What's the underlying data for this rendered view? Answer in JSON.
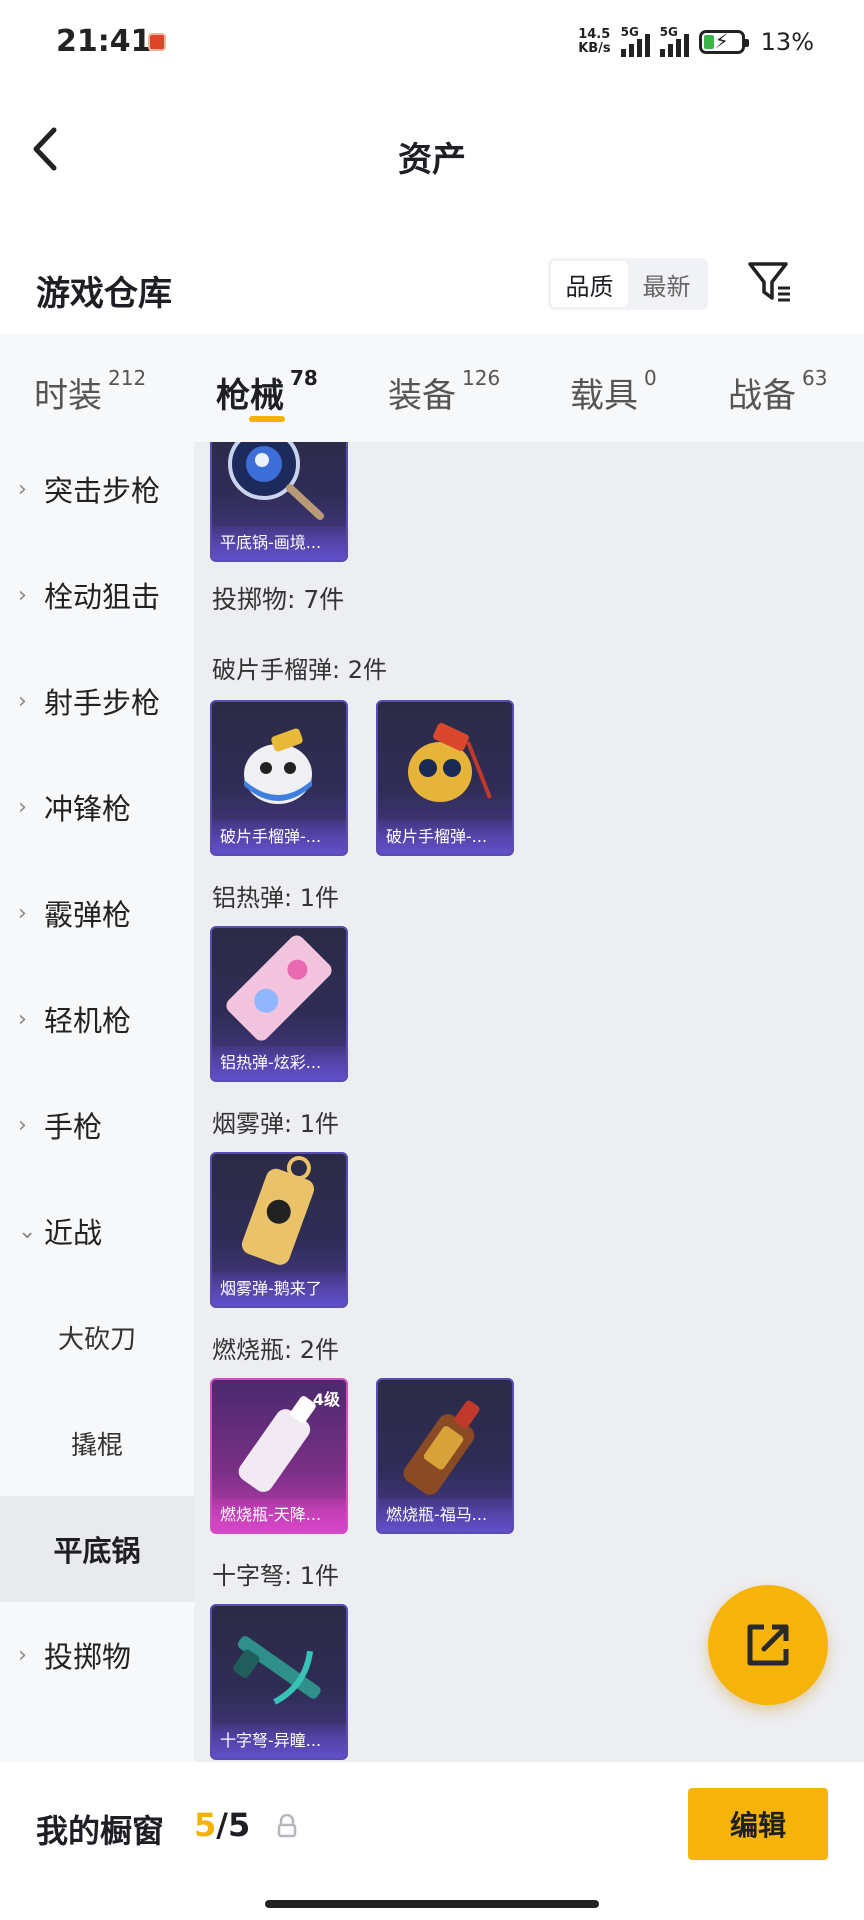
{
  "status_bar": {
    "time": "21:41",
    "speed_value": "14.5",
    "speed_unit": "KB/s",
    "network_1": "5G",
    "network_2": "5G",
    "battery": "13%"
  },
  "header": {
    "title": "资产"
  },
  "warehouse": {
    "title": "游戏仓库",
    "sort_options": [
      "品质",
      "最新"
    ],
    "sort_selected": "品质"
  },
  "tabs": [
    {
      "label": "时装",
      "count": "212"
    },
    {
      "label": "枪械",
      "count": "78"
    },
    {
      "label": "装备",
      "count": "126"
    },
    {
      "label": "载具",
      "count": "0"
    },
    {
      "label": "战备",
      "count": "63"
    }
  ],
  "active_tab": "枪械",
  "sidenav": {
    "items": [
      "突击步枪",
      "栓动狙击",
      "射手步枪",
      "冲锋枪",
      "霰弹枪",
      "轻机枪",
      "手枪",
      "近战"
    ],
    "sub_items": [
      "大砍刀",
      "撬棍",
      "平底锅"
    ],
    "selected_sub": "平底锅",
    "last_item": "投掷物"
  },
  "content": {
    "top_card_name": "平底锅-画境...",
    "group_title": "投掷物: 7件",
    "sections": [
      {
        "title": "破片手榴弹: 2件",
        "cards": [
          "破片手榴弹-...",
          "破片手榴弹-..."
        ]
      },
      {
        "title": "铝热弹: 1件",
        "cards": [
          "铝热弹-炫彩..."
        ]
      },
      {
        "title": "烟雾弹: 1件",
        "cards": [
          "烟雾弹-鹅来了"
        ]
      },
      {
        "title": "燃烧瓶: 2件",
        "cards": [
          "燃烧瓶-天降...",
          "燃烧瓶-福马..."
        ],
        "level_badge": "4级"
      },
      {
        "title": "十字弩: 1件",
        "cards": [
          "十字弩-异瞳..."
        ]
      }
    ]
  },
  "bottom_bar": {
    "label": "我的橱窗",
    "current": "5",
    "total": "/5",
    "edit_label": "编辑"
  },
  "colors": {
    "accent": "#f6b30a",
    "card_purple": "#5b4cb0",
    "card_pink": "#d24fc6"
  }
}
